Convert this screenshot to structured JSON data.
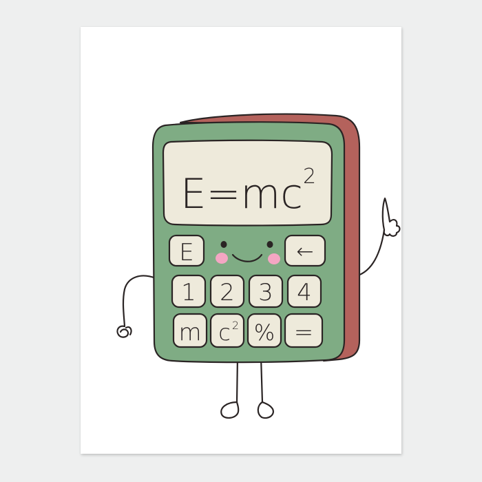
{
  "display": {
    "formula_base": "E=mc",
    "formula_exponent": "2"
  },
  "keys": {
    "row1": {
      "left": "E",
      "right": "←"
    },
    "row2": [
      "1",
      "2",
      "3",
      "4"
    ],
    "row3": {
      "m": "m",
      "c": "c",
      "c_exponent": "2",
      "percent": "%",
      "equals": "="
    }
  },
  "colors": {
    "body_green": "#7fac84",
    "body_side": "#b4625c",
    "screen_cream": "#eeeadb",
    "key_cream": "#eeeadb",
    "outline": "#2a2424",
    "cheek_pink": "#f4a6c3",
    "poster_white": "#ffffff",
    "wall_grey": "#eeefef"
  }
}
